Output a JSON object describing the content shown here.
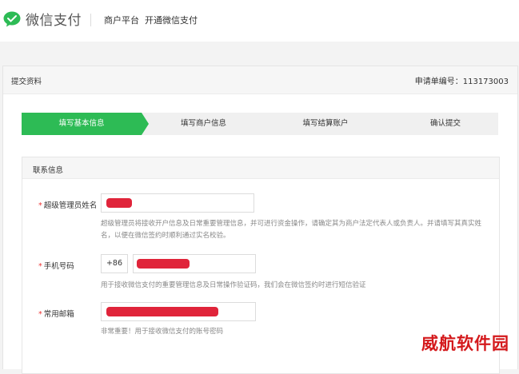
{
  "header": {
    "logo_icon": "wechat-pay-icon",
    "logo_text": "微信支付",
    "nav": [
      "商户平台",
      "开通微信支付"
    ]
  },
  "panel": {
    "title": "提交资料",
    "order_label": "申请单编号：",
    "order_no": "113173003"
  },
  "steps": [
    {
      "label": "填写基本信息",
      "active": true
    },
    {
      "label": "填写商户信息",
      "active": false
    },
    {
      "label": "填写结算账户",
      "active": false
    },
    {
      "label": "确认提交",
      "active": false
    }
  ],
  "contact": {
    "section_title": "联系信息",
    "fields": [
      {
        "label": "超级管理员姓名",
        "required": true,
        "value": "",
        "hint": "超级管理员将接收开户信息及日常重要管理信息，并可进行资金操作，请确定其为商户法定代表人或负责人。并请填写其真实姓名，以便在微信签约时顺利通过实名校验。"
      },
      {
        "label": "手机号码",
        "required": true,
        "prefix": "+86",
        "value": "",
        "hint": "用于接收微信支付的重要管理信息及日常操作验证码，我们会在微信签约时进行短信验证"
      },
      {
        "label": "常用邮箱",
        "required": true,
        "value": "",
        "hint": "非常重要！用于接收微信支付的账号密码"
      }
    ]
  },
  "watermark": "威航软件园",
  "colors": {
    "accent": "#2dbb55",
    "required": "#e33333",
    "redaction": "#e0243a",
    "watermark": "#d4191c"
  }
}
